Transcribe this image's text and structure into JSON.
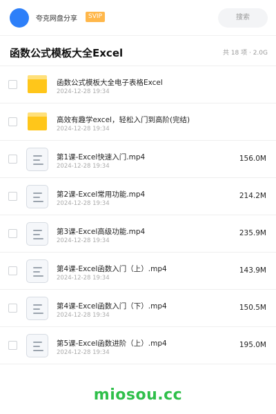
{
  "topbar": {
    "app_name": "夸克网盘分享",
    "badge": "SVIP",
    "search_placeholder": "搜索"
  },
  "header": {
    "title": "函数公式模板大全Excel",
    "meta": "共 18 项 · 2.0G"
  },
  "files": [
    {
      "name": "函数公式模板大全电子表格Excel",
      "date": "2024-12-28 19:34",
      "size": "",
      "type": "folder-icon"
    },
    {
      "name": "高效有趣学excel，轻松入门到高阶(完结)",
      "date": "2024-12-28 19:34",
      "size": "",
      "type": "folder-icon"
    },
    {
      "name": "第1课-Excel快速入门.mp4",
      "date": "2024-12-28 19:34",
      "size": "156.0M",
      "type": "file-icon"
    },
    {
      "name": "第2课-Excel常用功能.mp4",
      "date": "2024-12-28 19:34",
      "size": "214.2M",
      "type": "file-icon"
    },
    {
      "name": "第3课-Excel高级功能.mp4",
      "date": "2024-12-28 19:34",
      "size": "235.9M",
      "type": "file-icon"
    },
    {
      "name": "第4课-Excel函数入门（上）.mp4",
      "date": "2024-12-28 19:34",
      "size": "143.9M",
      "type": "file-icon"
    },
    {
      "name": "第4课-Excel函数入门（下）.mp4",
      "date": "2024-12-28 19:34",
      "size": "150.5M",
      "type": "file-icon"
    },
    {
      "name": "第5课-Excel函数进阶（上）.mp4",
      "date": "2024-12-28 19:34",
      "size": "195.0M",
      "type": "file-icon"
    }
  ],
  "watermark": "miosou.cc",
  "colors": {
    "accent": "#2d7ff9",
    "svip": "#ffb74a",
    "folder": "#ffc61a",
    "watermark": "#2fbf4a"
  }
}
